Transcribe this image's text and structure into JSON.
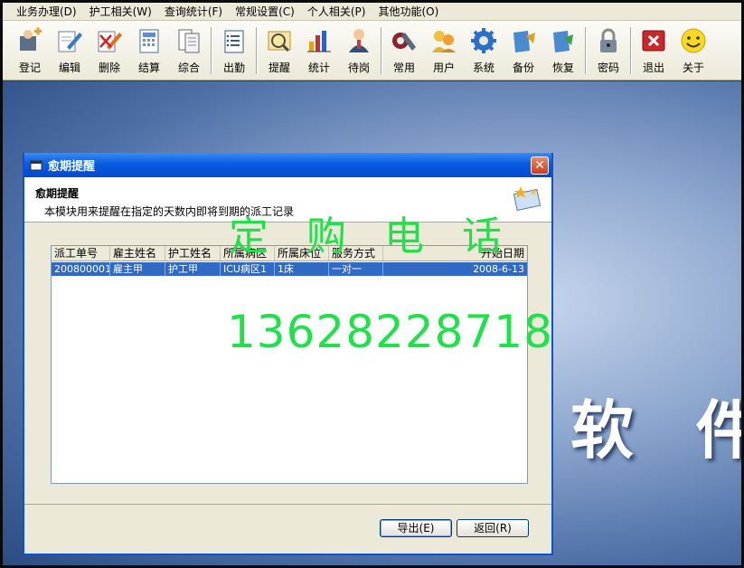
{
  "menubar": {
    "items": [
      "业务办理(D)",
      "护工相关(W)",
      "查询统计(F)",
      "常规设置(C)",
      "个人相关(P)",
      "其他功能(O)"
    ]
  },
  "toolbar": {
    "buttons": [
      {
        "label": "登记",
        "icon": "register-add-icon"
      },
      {
        "label": "编辑",
        "icon": "edit-pen-icon"
      },
      {
        "label": "删除",
        "icon": "delete-icon"
      },
      {
        "label": "结算",
        "icon": "settle-icon"
      },
      {
        "label": "综合",
        "icon": "overview-icon"
      },
      {
        "label": "出勤",
        "icon": "attendance-icon"
      },
      {
        "label": "提醒",
        "icon": "reminder-icon"
      },
      {
        "label": "统计",
        "icon": "bar-chart-icon"
      },
      {
        "label": "待岗",
        "icon": "waiting-person-icon"
      },
      {
        "label": "常用",
        "icon": "common-tools-icon"
      },
      {
        "label": "用户",
        "icon": "users-icon"
      },
      {
        "label": "系统",
        "icon": "gear-icon"
      },
      {
        "label": "备份",
        "icon": "backup-icon"
      },
      {
        "label": "恢复",
        "icon": "restore-icon"
      },
      {
        "label": "密码",
        "icon": "lock-icon"
      },
      {
        "label": "退出",
        "icon": "exit-icon"
      },
      {
        "label": "关于",
        "icon": "smiley-icon"
      }
    ]
  },
  "background": {
    "word": "软 件"
  },
  "dialog": {
    "title": "愈期提醒",
    "header_title": "愈期提醒",
    "header_desc": "本模块用来提醒在指定的天数内即将到期的派工记录",
    "columns": [
      "派工单号",
      "雇主姓名",
      "护工姓名",
      "所属病区",
      "所属床位",
      "服务方式",
      "开始日期"
    ],
    "rows": [
      [
        "200800001",
        "雇主甲",
        "护工甲",
        "ICU病区1",
        "1床",
        "一对一",
        "2008-6-13"
      ]
    ],
    "export_button": "导出(E)",
    "back_button": "返回(R)",
    "close_glyph": "✕"
  },
  "watermark": {
    "title": "定购电话",
    "phone": "13628228718"
  },
  "colors": {
    "titlebar": "#0a5ce0",
    "selection": "#316ac5",
    "watermark": "#1fe14a"
  }
}
